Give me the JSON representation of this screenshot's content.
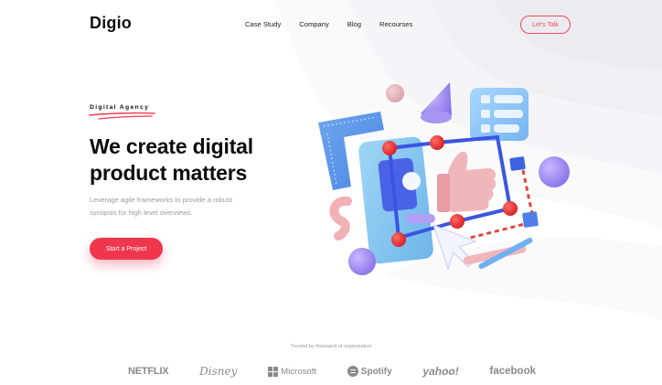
{
  "header": {
    "logo": "Digio",
    "nav": [
      {
        "label": "Case Study"
      },
      {
        "label": "Company"
      },
      {
        "label": "Blog"
      },
      {
        "label": "Recourses"
      }
    ],
    "cta_label": "Let's Talk"
  },
  "hero": {
    "eyebrow": "Digital Agency",
    "title_line1": "We create digital",
    "title_line2": "product matters",
    "description_line1": "Leverage agile frameworks to provide a robust",
    "description_line2": "synopsis for high level overviews.",
    "cta_label": "Start a Project"
  },
  "trusted": {
    "caption": "Trusted by thousand of organization",
    "brands": [
      "NETFLIX",
      "Disney",
      "Microsoft",
      "Spotify",
      "yahoo!",
      "facebook"
    ]
  },
  "colors": {
    "accent": "#f0364d",
    "text": "#0d0d0d",
    "muted": "#9a9aa3",
    "brand_gray": "#8a8a8a"
  }
}
